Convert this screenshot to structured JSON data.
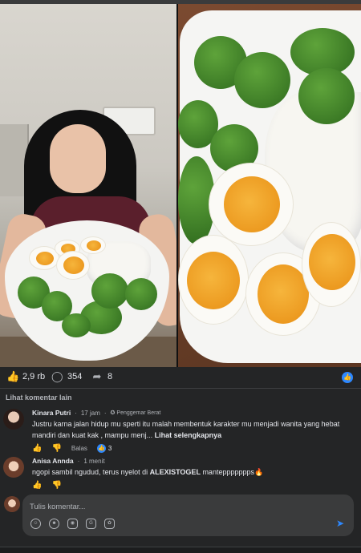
{
  "post": {
    "reaction_count": "2,9 rb",
    "comment_count": "354",
    "share_count": "8",
    "reaction_icon": "thumbs-up-icon"
  },
  "comments_section": {
    "more_comments_label": "Lihat komentar lain",
    "comments": [
      {
        "author": "Kinara Putri",
        "time": "17 jam",
        "badge": "Penggemar Berat",
        "text": "Justru karna jalan hidup mu sperti itu malah membentuk karakter mu menjadi wanita yang hebat mandiri dan kuat kak , mampu menj...",
        "see_more": "Lihat selengkapnya",
        "reply_label": "Balas",
        "reaction_count": "3"
      },
      {
        "author": "Anisa Annda",
        "time": "1 menit",
        "text_before": "ngopi sambil ngudud, terus nyelot di ",
        "text_brand": "ALEXISTOGEL",
        "text_after": " manteppppppps",
        "emoji": "🔥"
      }
    ]
  },
  "composer": {
    "placeholder": "Tulis komentar...",
    "tools": [
      "avatar-sticker-icon",
      "emoji-icon",
      "camera-icon",
      "gif-icon",
      "sticker-icon"
    ],
    "send_icon": "send-icon"
  },
  "colors": {
    "background": "#242526",
    "accent": "#2d88ff",
    "text_primary": "#e4e6eb",
    "text_secondary": "#b0b3b8"
  }
}
